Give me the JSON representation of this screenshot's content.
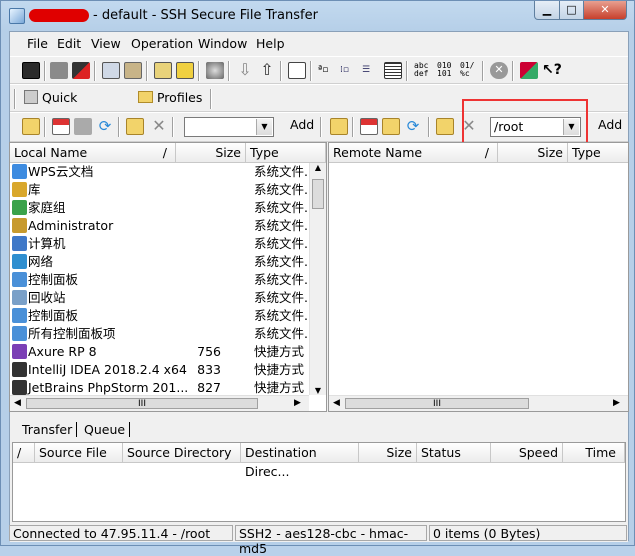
{
  "window": {
    "title": "- default - SSH Secure File Transfer",
    "minimize_glyph": "▁",
    "maximize_glyph": "□",
    "close_glyph": "✕"
  },
  "menu": [
    "File",
    "Edit",
    "View",
    "Operation",
    "Window",
    "Help"
  ],
  "toolbar2": {
    "quick_connect": "Quick Connect",
    "profiles": "Profiles"
  },
  "toolbar3": {
    "local_path": "",
    "remote_path": "/root",
    "add_left": "Add",
    "add_right": "Add"
  },
  "toolbar1_glyphs": {
    "text_mode_top": "abc",
    "text_mode_bottom": "def",
    "binary_mode_top": "010",
    "binary_mode_bottom": "101",
    "auto_mode_top": "01/",
    "auto_mode_bottom": "%c",
    "help_icon": "?"
  },
  "local_pane": {
    "headers": {
      "name": "Local Name",
      "size": "Size",
      "type": "Type",
      "sort_glyph": "/"
    },
    "rows": [
      {
        "name": "WPS云文档",
        "size": "",
        "type": "系统文件...",
        "icon": "cloud-icon",
        "color": "#3d8be0"
      },
      {
        "name": "库",
        "size": "",
        "type": "系统文件...",
        "icon": "library-icon",
        "color": "#d9a72b"
      },
      {
        "name": "家庭组",
        "size": "",
        "type": "系统文件...",
        "icon": "homegroup-icon",
        "color": "#3aa24a"
      },
      {
        "name": "Administrator",
        "size": "",
        "type": "系统文件...",
        "icon": "user-folder-icon",
        "color": "#c79a2e"
      },
      {
        "name": "计算机",
        "size": "",
        "type": "系统文件...",
        "icon": "computer-icon",
        "color": "#3f78c8"
      },
      {
        "name": "网络",
        "size": "",
        "type": "系统文件...",
        "icon": "network-icon",
        "color": "#2f8fd0"
      },
      {
        "name": "控制面板",
        "size": "",
        "type": "系统文件...",
        "icon": "control-panel-icon",
        "color": "#4a90d8"
      },
      {
        "name": "回收站",
        "size": "",
        "type": "系统文件...",
        "icon": "recycle-bin-icon",
        "color": "#7aa0c8"
      },
      {
        "name": "控制面板",
        "size": "",
        "type": "系统文件...",
        "icon": "control-panel-icon",
        "color": "#4a90d8"
      },
      {
        "name": "所有控制面板项",
        "size": "",
        "type": "系统文件...",
        "icon": "control-panel-icon",
        "color": "#4a90d8"
      },
      {
        "name": "Axure RP 8",
        "size": "756",
        "type": "快捷方式",
        "icon": "axure-icon",
        "color": "#7b3fb5"
      },
      {
        "name": "IntelliJ IDEA 2018.2.4 x64",
        "size": "833",
        "type": "快捷方式",
        "icon": "intellij-icon",
        "color": "#333333"
      },
      {
        "name": "JetBrains PhpStorm 201...",
        "size": "827",
        "type": "快捷方式",
        "icon": "phpstorm-icon",
        "color": "#333333"
      }
    ]
  },
  "remote_pane": {
    "headers": {
      "name": "Remote Name",
      "size": "Size",
      "type": "Type",
      "sort_glyph": "/"
    }
  },
  "scroll_glyphs": {
    "left": "◀",
    "right": "▶",
    "up": "▲",
    "down": "▼",
    "grip": "III"
  },
  "transfer_tabs": [
    "Transfer",
    "Queue"
  ],
  "transfer_headers": {
    "sort_glyph": "/",
    "source_file": "Source File",
    "source_dir": "Source Directory",
    "dest_dir": "Destination Direc...",
    "size": "Size",
    "status": "Status",
    "speed": "Speed",
    "time": "Time"
  },
  "status": {
    "connection": "Connected to 47.95.11.4 - /root",
    "cipher": "SSH2 - aes128-cbc - hmac-md5",
    "items": "0 items (0 Bytes)"
  }
}
